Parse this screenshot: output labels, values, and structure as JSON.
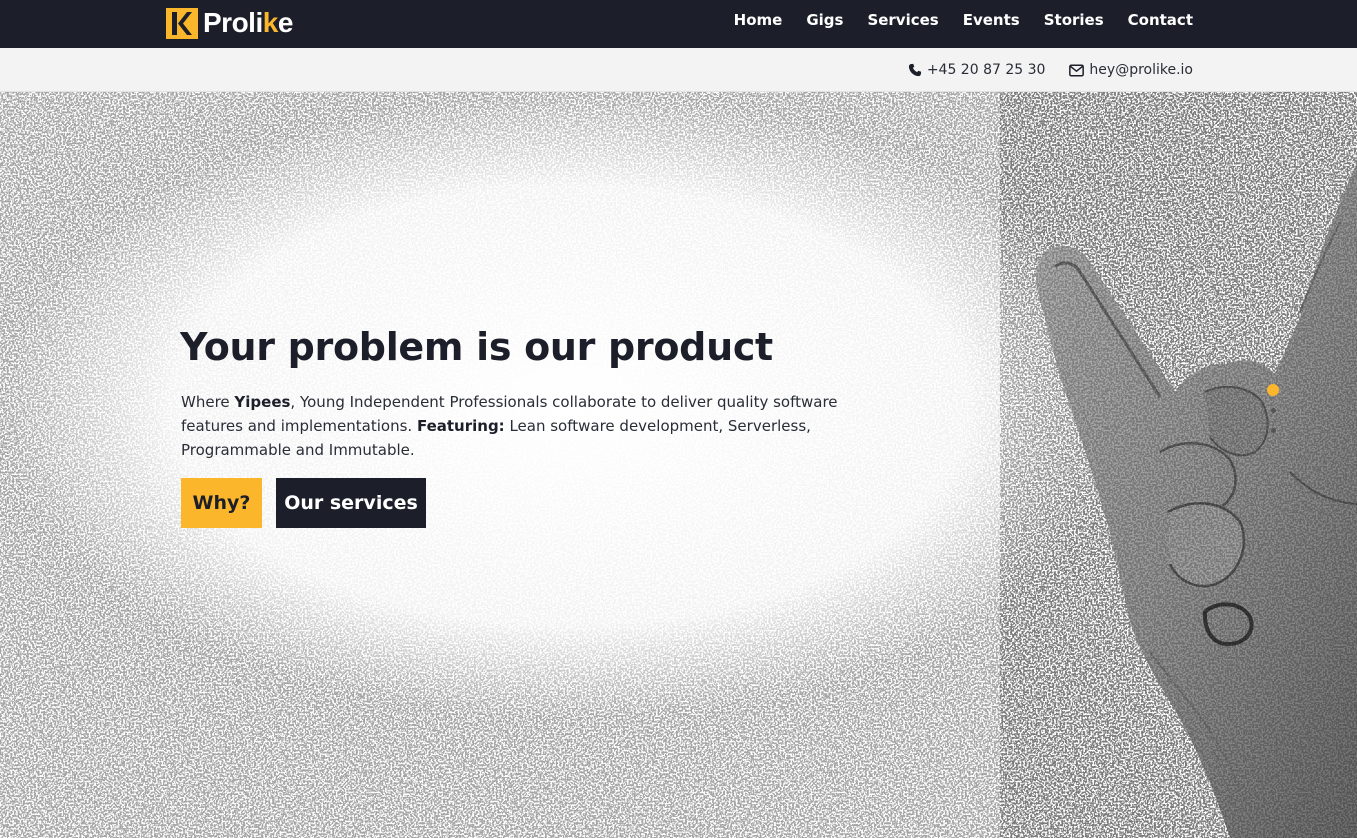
{
  "brand": {
    "name_part1": "Proli",
    "name_accent": "k",
    "name_part2": "e",
    "accent_color": "#fbb62c",
    "dark_color": "#1c1f2a"
  },
  "nav": {
    "items": [
      {
        "label": "Home"
      },
      {
        "label": "Gigs"
      },
      {
        "label": "Services"
      },
      {
        "label": "Events"
      },
      {
        "label": "Stories"
      },
      {
        "label": "Contact"
      }
    ]
  },
  "contact": {
    "phone": {
      "icon": "phone-icon",
      "text": "+45 20 87 25 30"
    },
    "email": {
      "icon": "envelope-icon",
      "text": "hey@prolike.io"
    }
  },
  "hero": {
    "headline": "Your problem is our product",
    "lead": {
      "t1": "Where ",
      "b1": "Yipees",
      "t2": ", Young Independent Professionals collaborate to deliver quality software features and implementations. ",
      "b2": "Featuring:",
      "t3": " Lean software development, Serverless, Programmable and Immutable."
    },
    "buttons": {
      "why": "Why?",
      "services": "Our services"
    },
    "image": "rock-hand-gesture-photo"
  },
  "slider": {
    "slide_count": 3,
    "active_index": 0
  }
}
